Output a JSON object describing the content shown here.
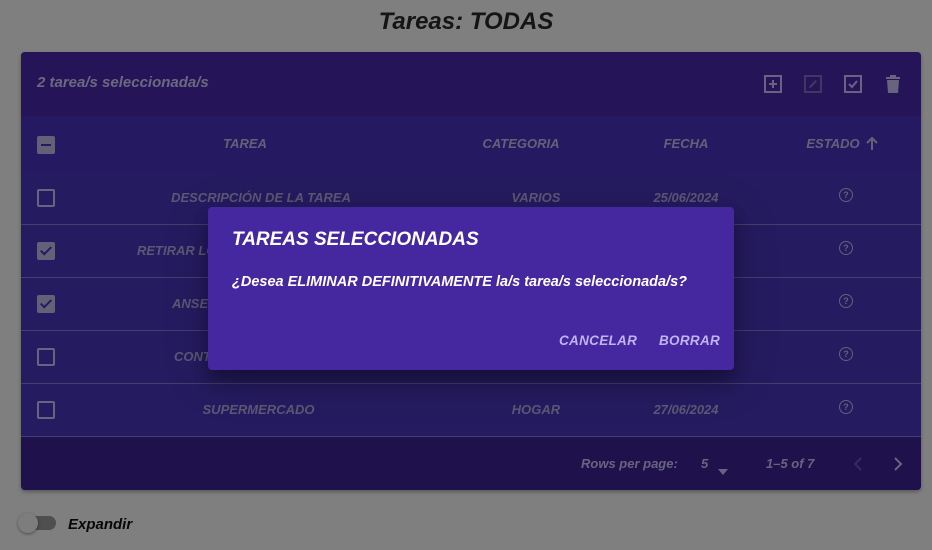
{
  "page": {
    "title": "Tareas: TODAS"
  },
  "toolbar": {
    "selection_text": "2 tarea/s seleccionada/s",
    "icons": [
      "add-box-icon",
      "edit-icon",
      "check-box-icon",
      "delete-icon"
    ]
  },
  "table": {
    "columns": [
      "TAREA",
      "CATEGORIA",
      "FECHA",
      "ESTADO"
    ],
    "sort_icon": "arrow-up-icon",
    "rows": [
      {
        "tarea": "DESCRIPCIÓN DE LA TAREA",
        "categoria": "VARIOS",
        "fecha": "25/06/2024",
        "checked": false
      },
      {
        "tarea": "RETIRAR LO",
        "categoria": "",
        "fecha": "",
        "checked": true
      },
      {
        "tarea": "ANSE",
        "categoria": "",
        "fecha": "",
        "checked": true
      },
      {
        "tarea": "CONT",
        "categoria": "",
        "fecha": "",
        "checked": false
      },
      {
        "tarea": "SUPERMERCADO",
        "categoria": "HOGAR",
        "fecha": "27/06/2024",
        "checked": false
      }
    ]
  },
  "pagination": {
    "rows_per_page_label": "Rows per page:",
    "rows_per_page_value": "5",
    "range_label": "1–5 of 7"
  },
  "dialog": {
    "title": "TAREAS SELECCIONADAS",
    "message": "¿Desea ELIMINAR DEFINITIVAMENTE la/s tarea/s seleccionada/s?",
    "cancel_label": "CANCELAR",
    "confirm_label": "BORRAR"
  },
  "bottom": {
    "toggle_label": "Expandir"
  },
  "colors": {
    "dialog_bg": "#4527a0",
    "table_bg": "#3a2a9a",
    "overlay": "rgba(0,0,0,0.5)"
  }
}
